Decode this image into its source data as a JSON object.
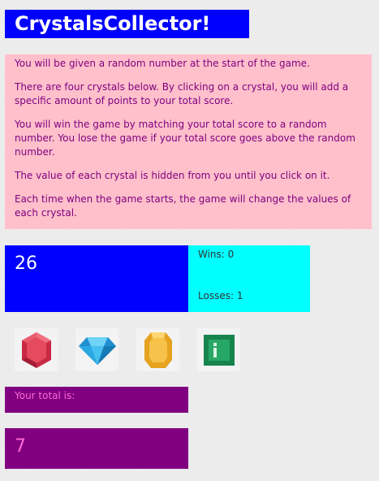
{
  "title": "CrystalsCollector!",
  "instructions": [
    "You will be given a random number at the start of the game.",
    "There are four crystals below. By clicking on a crystal, you will add a specific amount of points to your total score.",
    "You will win the game by matching your total score to a random number. You lose the game if your total score goes above the random number.",
    "The value of each crystal is hidden from you until you click on it.",
    "Each time when the game starts, the game will change the values of each crystal."
  ],
  "game": {
    "target_number": "26",
    "wins": "Wins: 0",
    "losses": "Losses: 1",
    "total_label": "Your total is:",
    "total_value": "7"
  },
  "crystals": [
    {
      "icon": "red-crystal-icon",
      "color": "#d2344a"
    },
    {
      "icon": "blue-diamond-icon",
      "color": "#29a9e0"
    },
    {
      "icon": "yellow-crystal-icon",
      "color": "#f2b630"
    },
    {
      "icon": "green-crystal-icon",
      "color": "#1e9a5c"
    }
  ]
}
